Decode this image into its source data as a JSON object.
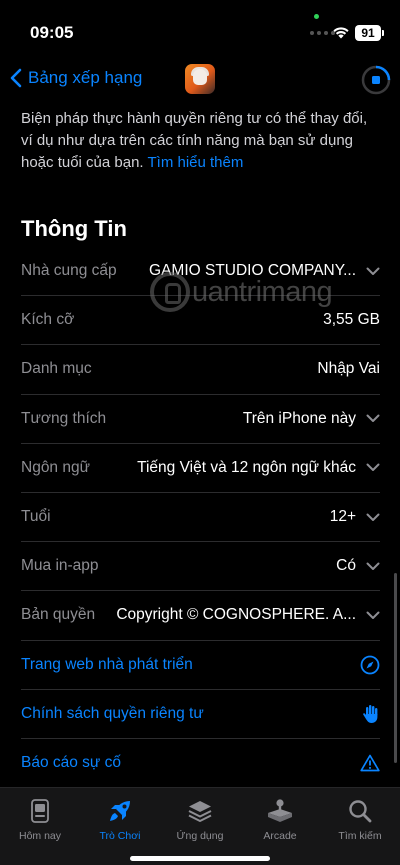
{
  "status": {
    "time": "09:05",
    "battery": "91"
  },
  "nav": {
    "back_label": "Bảng xếp hạng"
  },
  "description": {
    "text": "Biện pháp thực hành quyền riêng tư có thể thay đổi, ví dụ như dựa trên các tính năng mà bạn sử dụng hoặc tuổi của bạn.",
    "link": "Tìm hiểu thêm"
  },
  "info": {
    "title": "Thông Tin",
    "rows": [
      {
        "label": "Nhà cung cấp",
        "value": "GAMIO STUDIO COMPANY...",
        "expandable": true
      },
      {
        "label": "Kích cỡ",
        "value": "3,55 GB",
        "expandable": false
      },
      {
        "label": "Danh mục",
        "value": "Nhập Vai",
        "expandable": false
      },
      {
        "label": "Tương thích",
        "value": "Trên iPhone này",
        "expandable": true
      },
      {
        "label": "Ngôn ngữ",
        "value": "Tiếng Việt và 12 ngôn ngữ khác",
        "expandable": true
      },
      {
        "label": "Tuổi",
        "value": "12+",
        "expandable": true
      },
      {
        "label": "Mua in-app",
        "value": "Có",
        "expandable": true
      },
      {
        "label": "Bản quyền",
        "value": "Copyright © COGNOSPHERE. A...",
        "expandable": true
      }
    ],
    "links": [
      {
        "label": "Trang web nhà phát triển",
        "icon": "compass-icon"
      },
      {
        "label": "Chính sách quyền riêng tư",
        "icon": "hand-icon"
      },
      {
        "label": "Báo cáo sự cố",
        "icon": "warning-icon"
      }
    ]
  },
  "watermark": {
    "text": "uantrimang"
  },
  "tabs": [
    {
      "label": "Hôm nay",
      "icon": "today-icon",
      "active": false
    },
    {
      "label": "Trò Chơi",
      "icon": "rocket-icon",
      "active": true
    },
    {
      "label": "Ứng dụng",
      "icon": "apps-icon",
      "active": false
    },
    {
      "label": "Arcade",
      "icon": "joystick-icon",
      "active": false
    },
    {
      "label": "Tìm kiếm",
      "icon": "search-icon",
      "active": false
    }
  ],
  "colors": {
    "accent": "#0a84ff",
    "background": "#000000",
    "separator": "#2c2c2e",
    "secondary_text": "#8e8e93"
  }
}
